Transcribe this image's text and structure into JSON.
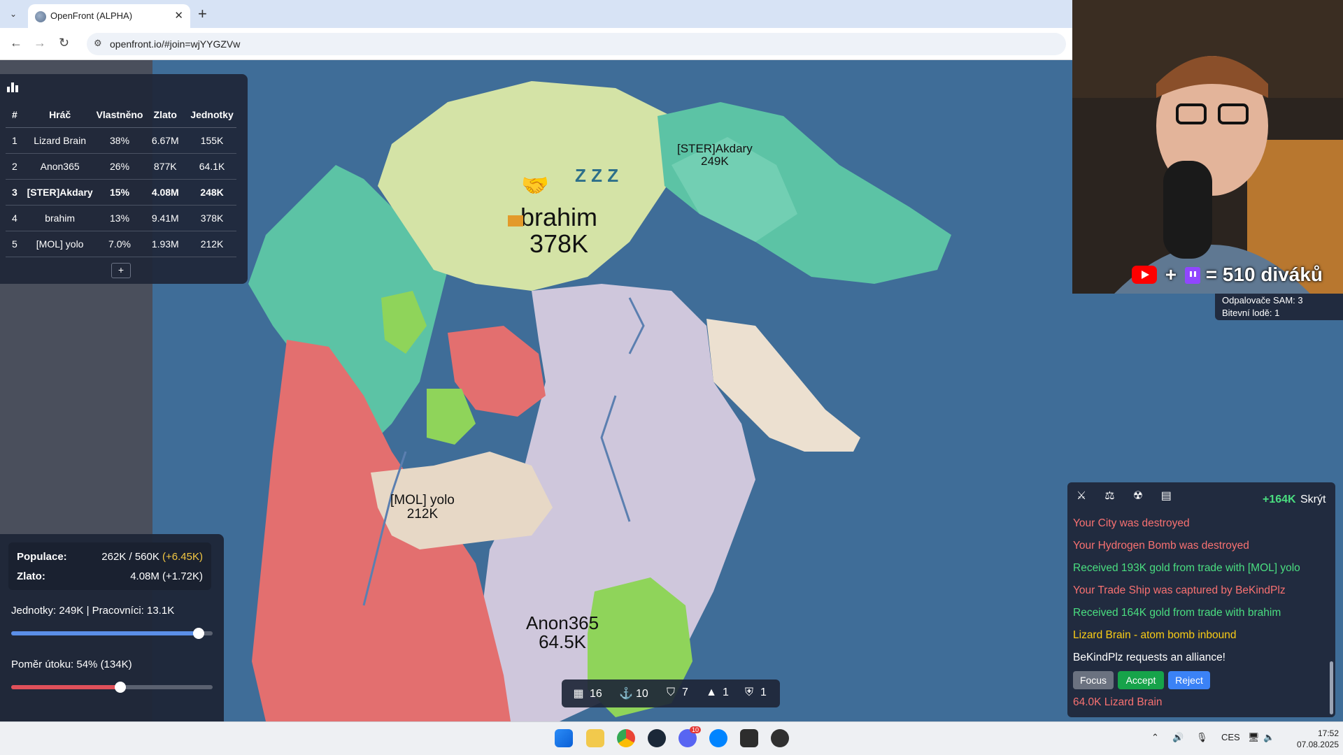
{
  "browser": {
    "tab_title": "OpenFront (ALPHA)",
    "url": "openfront.io/#join=wjYYGZVw",
    "tab_close": "✕",
    "new_tab": "+",
    "tab_dropdown": "⌄",
    "back": "←",
    "forward": "→",
    "reload": "↻"
  },
  "leaderboard": {
    "columns": [
      "#",
      "Hráč",
      "Vlastněno",
      "Zlato",
      "Jednotky"
    ],
    "rows": [
      {
        "rank": "1",
        "player": "Lizard Brain",
        "owned": "38%",
        "gold": "6.67M",
        "units": "155K"
      },
      {
        "rank": "2",
        "player": "Anon365",
        "owned": "26%",
        "gold": "877K",
        "units": "64.1K"
      },
      {
        "rank": "3",
        "player": "[STER]Akdary",
        "owned": "15%",
        "gold": "4.08M",
        "units": "248K"
      },
      {
        "rank": "4",
        "player": "brahim",
        "owned": "13%",
        "gold": "9.41M",
        "units": "378K"
      },
      {
        "rank": "5",
        "player": "[MOL] yolo",
        "owned": "7.0%",
        "gold": "1.93M",
        "units": "212K"
      }
    ],
    "expand": "+"
  },
  "map_labels": {
    "brahim_name": "brahim",
    "brahim_troops": "378K",
    "akdary_name": "[STER]Akdary",
    "akdary_troops": "249K",
    "yolo_name": "[MOL] yolo",
    "yolo_troops": "212K",
    "anon_name": "Anon365",
    "anon_troops": "64.5K",
    "sleep": "Z Z Z"
  },
  "stats": {
    "population_label": "Populace:",
    "population_value": "262K / 560K",
    "population_delta": "(+6.45K)",
    "gold_label": "Zlato:",
    "gold_value": "4.08M (+1.72K)",
    "units_line": "Jednotky: 249K | Pracovníci: 13.1K",
    "units_ratio": 0.93,
    "attack_line": "Poměr útoku: 54% (134K)",
    "attack_ratio": 0.54
  },
  "buildbar": {
    "city": "16",
    "port": "10",
    "defense": "7",
    "silo": "1",
    "sam": "1"
  },
  "player_panel": {
    "sam": "Odpalovače SAM: 3",
    "warships": "Bitevní lodě: 1"
  },
  "events": {
    "gold": "+164K",
    "hide": "Skrýt",
    "messages": [
      {
        "text": "Your City was destroyed",
        "color": "red"
      },
      {
        "text": "Your Hydrogen Bomb was destroyed",
        "color": "red"
      },
      {
        "text": "Received 193K gold from trade with [MOL] yolo",
        "color": "green"
      },
      {
        "text": "Your Trade Ship was captured by BeKindPlz",
        "color": "red"
      },
      {
        "text": "Received 164K gold from trade with brahim",
        "color": "green"
      },
      {
        "text": "Lizard Brain - atom bomb inbound",
        "color": "yellow"
      },
      {
        "text": "BeKindPlz requests an alliance!",
        "color": "white"
      }
    ],
    "focus": "Focus",
    "accept": "Accept",
    "reject": "Reject",
    "last": "64.0K Lizard Brain"
  },
  "stream": {
    "viewers": "= 510 diváků"
  },
  "taskbar": {
    "lang": "CES",
    "time": "17:52",
    "date": "07.08.2025",
    "discord_badge": "10"
  },
  "colors": {
    "ocean": "#3f6d98",
    "teal": "#5cc3a5",
    "light_green": "#c8dd9f",
    "red": "#e36f6f",
    "lilac": "#cfc7dc",
    "beige": "#e7d8c6",
    "lime": "#8fd45a"
  }
}
